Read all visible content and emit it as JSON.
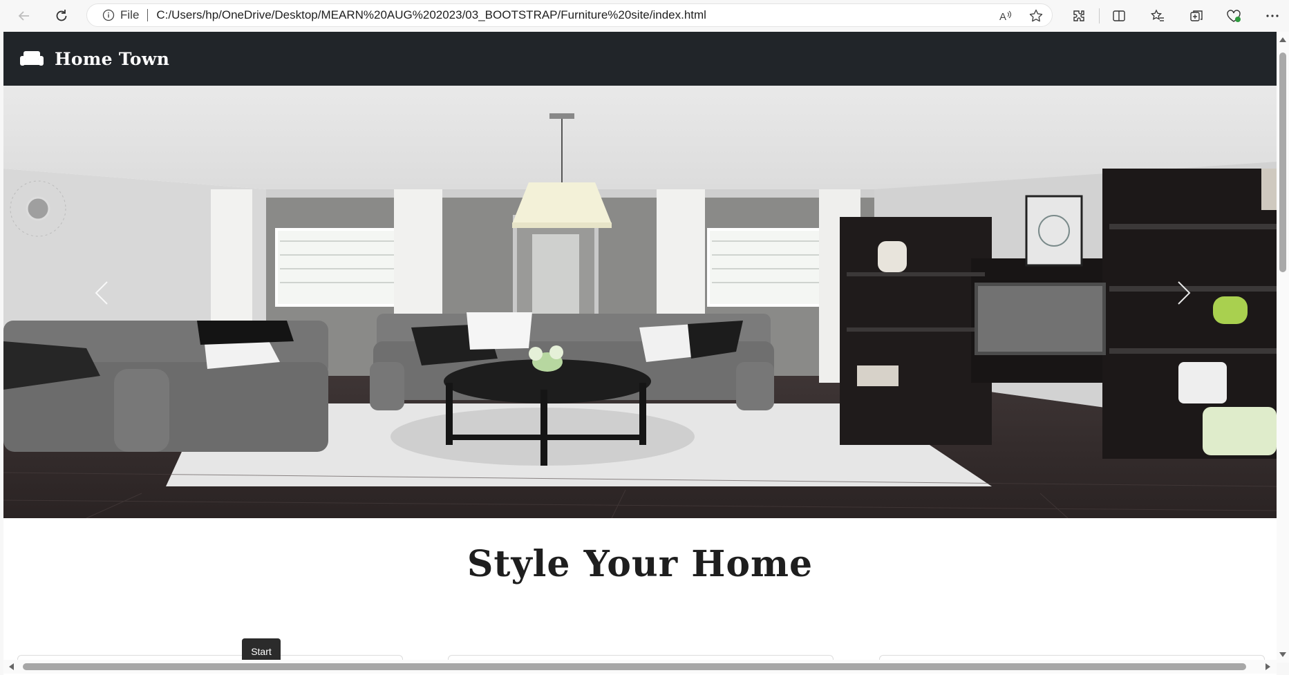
{
  "browser": {
    "address_prefix": "File",
    "url": "C:/Users/hp/OneDrive/Desktop/MEARN%20AUG%202023/03_BOOTSTRAP/Furniture%20site/index.html",
    "icons": [
      "back-icon",
      "refresh-icon",
      "info-icon",
      "read-aloud-icon",
      "favorite-star-icon",
      "extensions-icon",
      "split-screen-icon",
      "favorites-icon",
      "collections-icon",
      "browser-essentials-icon",
      "more-icon"
    ]
  },
  "page": {
    "brand": "Home Town",
    "brand_icon": "sofa-icon",
    "heading": "Style Your Home",
    "carousel": {
      "prev_icon": "chevron-left-icon",
      "next_icon": "chevron-right-icon"
    },
    "tooltip": "Start"
  },
  "colors": {
    "navbar_bg": "#212529",
    "text_dark": "#1e1e1e"
  }
}
